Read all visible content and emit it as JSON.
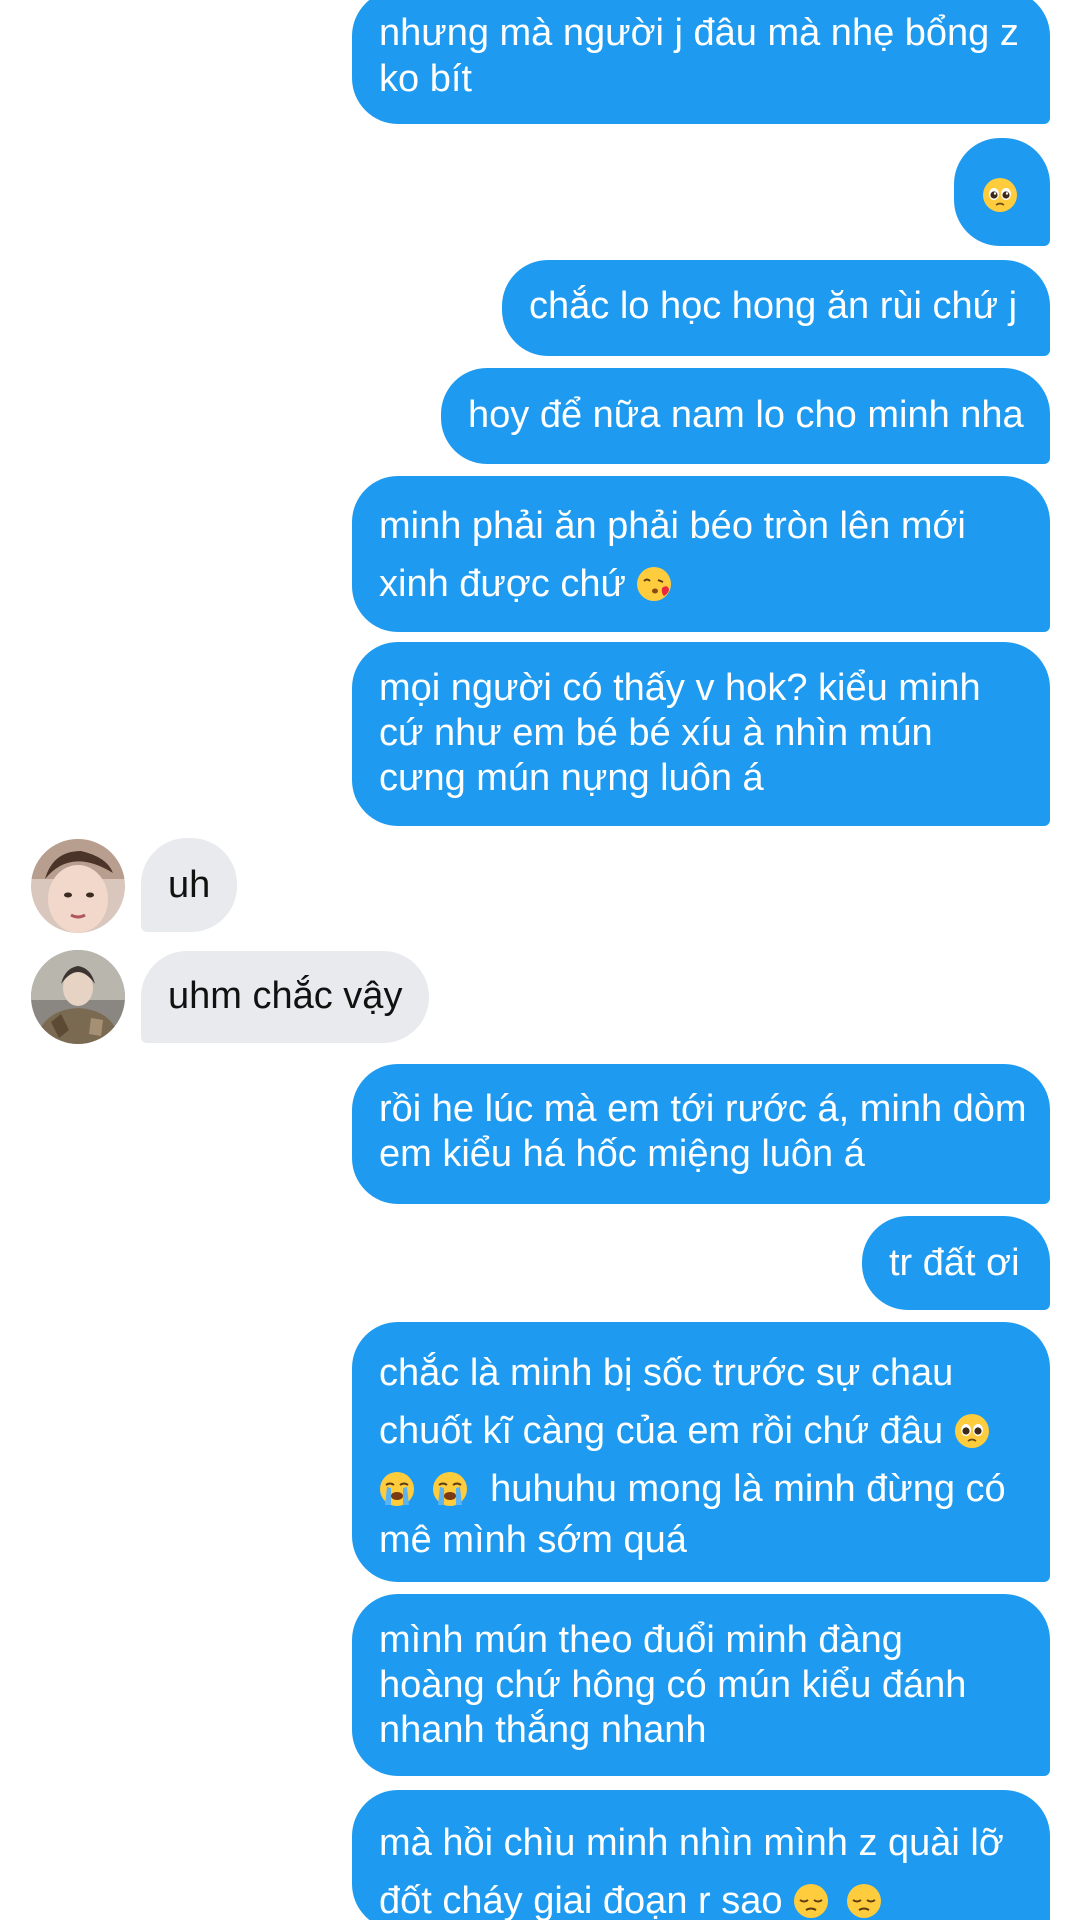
{
  "colors": {
    "sent_bubble": "#1e9bf0",
    "received_bubble": "#e8eaed",
    "background": "#ffffff"
  },
  "messages": [
    {
      "from": "me",
      "lines": [
        "nhưng mà người j đâu mà nhẹ bổng z",
        "ko bít"
      ]
    },
    {
      "from": "me",
      "emoji": [
        "pleading-face"
      ]
    },
    {
      "from": "me",
      "lines": [
        "chắc lo học hong ăn rùi chứ j"
      ]
    },
    {
      "from": "me",
      "lines": [
        "hoy để nữa nam lo cho minh nha"
      ]
    },
    {
      "from": "me",
      "lines": [
        "minh phải ăn phải béo tròn lên mới",
        "xinh được chứ"
      ],
      "trailing_emoji": [
        "face-blowing-kiss"
      ]
    },
    {
      "from": "me",
      "lines": [
        "mọi người có thấy v hok? kiểu minh",
        "cứ như em bé bé xíu à nhìn mún",
        "cưng mún nựng luôn á"
      ]
    },
    {
      "from": "other",
      "avatar": "contact-avatar-1",
      "lines": [
        "uh"
      ]
    },
    {
      "from": "other",
      "avatar": "contact-avatar-2",
      "lines": [
        "uhm chắc vậy"
      ]
    },
    {
      "from": "me",
      "lines": [
        "rồi he lúc mà em tới rước á, minh dòm",
        "em kiểu há hốc miệng luôn á"
      ]
    },
    {
      "from": "me",
      "lines": [
        "tr đất ơi"
      ]
    },
    {
      "from": "me",
      "lines": [
        "chắc là minh bị sốc trước sự chau",
        "chuốt kĩ càng của em rồi chứ đâu",
        "huhuhu mong là minh đừng có",
        "mê mình sớm quá"
      ],
      "emoji_after_line_2": [
        "pleading-face"
      ],
      "emoji_before_line_3": [
        "loudly-crying-face",
        "loudly-crying-face"
      ]
    },
    {
      "from": "me",
      "lines": [
        "mình mún theo đuổi minh đàng",
        "hoàng chứ hông có mún kiểu đánh",
        "nhanh thắng nhanh"
      ]
    },
    {
      "from": "me",
      "lines": [
        "mà hồi chìu minh nhìn mình z quài lỡ",
        "đốt cháy giai đoạn r sao"
      ],
      "trailing_emoji": [
        "pensive-face",
        "pensive-face"
      ]
    }
  ]
}
